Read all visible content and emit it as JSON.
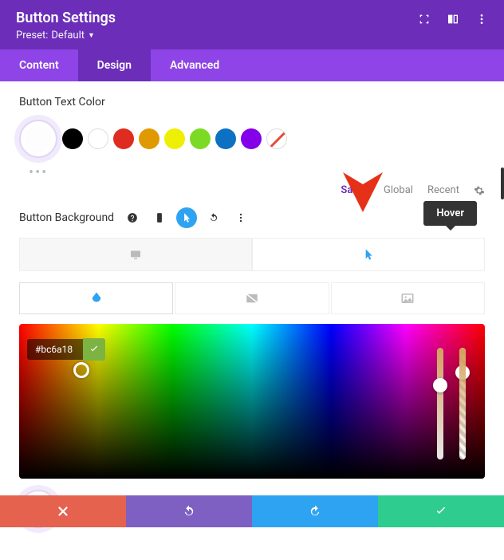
{
  "header": {
    "title": "Button Settings",
    "preset_label": "Preset:",
    "preset_value": "Default"
  },
  "tabs": {
    "content": "Content",
    "design": "Design",
    "advanced": "Advanced"
  },
  "section": {
    "text_color_label": "Button Text Color",
    "background_label": "Button Background"
  },
  "swatches_text": [
    {
      "color": "#000000"
    },
    {
      "color": "#ffffff",
      "white": true
    },
    {
      "color": "#e02b20"
    },
    {
      "color": "#e09900"
    },
    {
      "color": "#edf000"
    },
    {
      "color": "#7cda24"
    },
    {
      "color": "#0c71c3"
    },
    {
      "color": "#8300e9"
    },
    {
      "none": true
    }
  ],
  "swatches_bg": [
    {
      "color": "#000000"
    },
    {
      "color": "#ffffff",
      "white": true
    },
    {
      "color": "#e02b20"
    },
    {
      "color": "#e09900"
    },
    {
      "color": "#edf000"
    },
    {
      "color": "#7cda24"
    },
    {
      "color": "#0c71c3"
    },
    {
      "color": "#8300e9"
    },
    {
      "none": true
    }
  ],
  "save_row": {
    "saved": "Saved",
    "global": "Global",
    "recent": "Recent"
  },
  "picker": {
    "hex": "#bc6a18"
  },
  "tooltip": {
    "hover": "Hover"
  }
}
